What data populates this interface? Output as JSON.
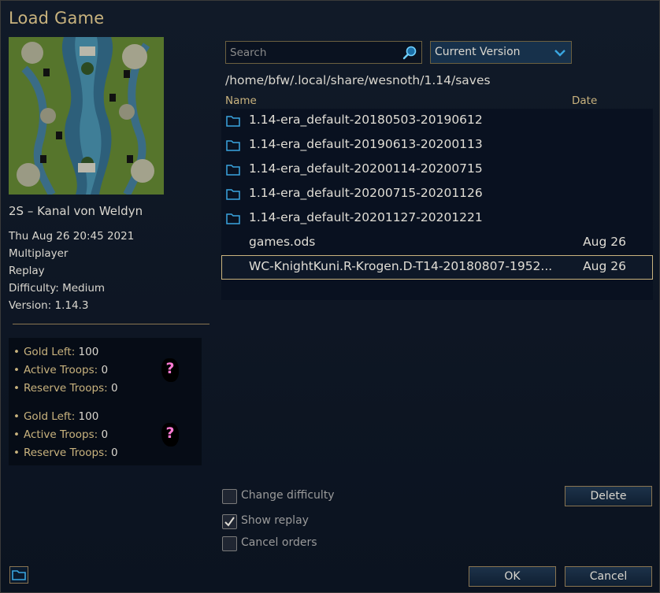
{
  "window": {
    "title": "Load Game"
  },
  "scenario": {
    "title": "2S – Kanal von Weldyn",
    "date": "Thu Aug 26 20:45 2021",
    "mode": "Multiplayer",
    "type": "Replay",
    "difficulty": "Difficulty: Medium",
    "version": "Version: 1.14.3"
  },
  "players": [
    {
      "gold_label": "Gold Left:",
      "gold": "100",
      "active_label": "Active Troops:",
      "active": "0",
      "reserve_label": "Reserve Troops:",
      "reserve": "0",
      "portrait": "?"
    },
    {
      "gold_label": "Gold Left:",
      "gold": "100",
      "active_label": "Active Troops:",
      "active": "0",
      "reserve_label": "Reserve Troops:",
      "reserve": "0",
      "portrait": "?"
    }
  ],
  "search": {
    "placeholder": "Search",
    "value": "",
    "icon": "search-icon"
  },
  "version_filter": {
    "selected": "Current Version",
    "icon": "chevron-down-icon"
  },
  "path": "/home/bfw/.local/share/wesnoth/1.14/saves",
  "columns": {
    "name": "Name",
    "date": "Date"
  },
  "files": [
    {
      "name": "1.14-era_default-20180503-20190612",
      "date": "",
      "folder": true
    },
    {
      "name": "1.14-era_default-20190613-20200113",
      "date": "",
      "folder": true
    },
    {
      "name": "1.14-era_default-20200114-20200715",
      "date": "",
      "folder": true
    },
    {
      "name": "1.14-era_default-20200715-20201126",
      "date": "",
      "folder": true
    },
    {
      "name": "1.14-era_default-20201127-20201221",
      "date": "",
      "folder": true
    },
    {
      "name": "games.ods",
      "date": "Aug 26",
      "folder": false
    },
    {
      "name": "WC-KnightKuni.R-Krogen.D-T14-20180807-1952...",
      "date": "Aug 26",
      "folder": false,
      "selected": true
    }
  ],
  "options": {
    "change_difficulty": {
      "label": "Change difficulty",
      "checked": false
    },
    "show_replay": {
      "label": "Show replay",
      "checked": true
    },
    "cancel_orders": {
      "label": "Cancel orders",
      "checked": false
    }
  },
  "buttons": {
    "delete": "Delete",
    "ok": "OK",
    "cancel": "Cancel"
  },
  "colors": {
    "accent": "#c9b37e",
    "background": "#0c1421",
    "selection_border": "#c9b37e",
    "folder_icon": "#3aa6e0",
    "unknown_portrait": "#ff7bd4"
  }
}
